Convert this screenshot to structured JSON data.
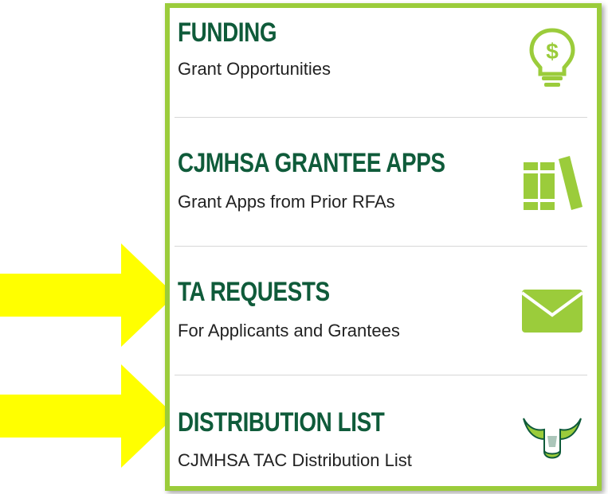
{
  "colors": {
    "accent_green": "#9bcc3b",
    "title_green": "#0f5b3a",
    "arrow_yellow": "#ffff00"
  },
  "links": [
    {
      "title": "FUNDING",
      "subtitle": "Grant Opportunities",
      "icon": "lightbulb-dollar-icon"
    },
    {
      "title": "CJMHSA GRANTEE APPS",
      "subtitle": "Grant Apps from Prior RFAs",
      "icon": "books-icon"
    },
    {
      "title": "TA REQUESTS",
      "subtitle": "For Applicants and Grantees",
      "icon": "envelope-icon"
    },
    {
      "title": "DISTRIBUTION LIST",
      "subtitle": "CJMHSA TAC Distribution List",
      "icon": "bull-horns-icon"
    }
  ],
  "annotations": [
    {
      "type": "arrow",
      "icon": "yellow-arrow-icon",
      "points_to": "TA REQUESTS"
    },
    {
      "type": "arrow",
      "icon": "yellow-arrow-icon",
      "points_to": "DISTRIBUTION LIST"
    }
  ]
}
